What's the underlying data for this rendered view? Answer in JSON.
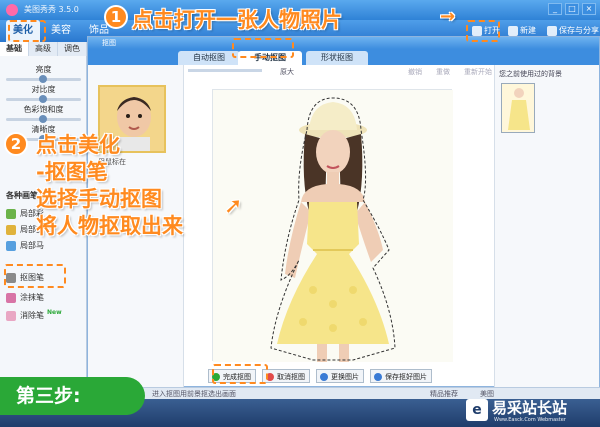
{
  "app": {
    "title": "美图秀秀 3.5.0"
  },
  "window_controls": [
    "_",
    "□",
    "×"
  ],
  "main_tabs": [
    {
      "label": "美化"
    },
    {
      "label": "美容"
    },
    {
      "label": "饰品"
    }
  ],
  "toolbar_right": {
    "open": "打开",
    "new": "新建",
    "save": "保存与分享"
  },
  "left_panel": {
    "subtabs": [
      "基础",
      "高级",
      "调色"
    ],
    "sliders": [
      {
        "label": "亮度",
        "value": 0.5
      },
      {
        "label": "对比度",
        "value": 0.5
      },
      {
        "label": "色彩饱和度",
        "value": 0.5
      },
      {
        "label": "清晰度",
        "value": 0.5
      }
    ],
    "tools_title": "各种画笔",
    "tools": [
      {
        "label": "局部彩",
        "color": "#6bb34a"
      },
      {
        "label": "局部变",
        "color": "#e0b33c"
      },
      {
        "label": "局部马",
        "color": "#57a0df"
      },
      {
        "label": "抠图笔",
        "color": "#8a8a8a"
      },
      {
        "label": "涂抹笔",
        "color": "#d874a6"
      },
      {
        "label": "消除笔",
        "color": "#e9a7c4",
        "badge": "New"
      }
    ]
  },
  "dialog": {
    "title": "抠图",
    "tabs": [
      {
        "label": "自动抠图"
      },
      {
        "label": "手动抠图"
      },
      {
        "label": "形状抠图"
      }
    ],
    "thumb_label": "用鼠标在",
    "zoom_label": "原大",
    "undo": [
      "撤销",
      "重做",
      "重新开始"
    ],
    "right_label": "您之前使用过的背景",
    "buttons": [
      {
        "label": "完成抠图",
        "color": "#2aa837"
      },
      {
        "label": "取消抠图",
        "color": "#e14b4b"
      },
      {
        "label": "更换图片",
        "color": "#3a7bd5"
      },
      {
        "label": "保存抠好图片",
        "color": "#3a7bd5"
      }
    ]
  },
  "status": {
    "left": "进入抠图用前景抠选出画面",
    "right": "精品推荐",
    "app": "美图"
  },
  "annotations": {
    "step1_num": "1",
    "step1_text": "点击打开一张人物照片",
    "step2_num": "2",
    "step2_lines": [
      "点击美化",
      "-抠图笔",
      "选择手动抠图",
      "将人物抠取出来"
    ],
    "step_badge": "第三步:"
  },
  "watermark": {
    "name": "易采站长站",
    "url": "Www.Easck.Com Webmaster"
  },
  "colors": {
    "accent": "#ff8a1f",
    "brand": "#2f82d6",
    "step": "#2aa837"
  }
}
